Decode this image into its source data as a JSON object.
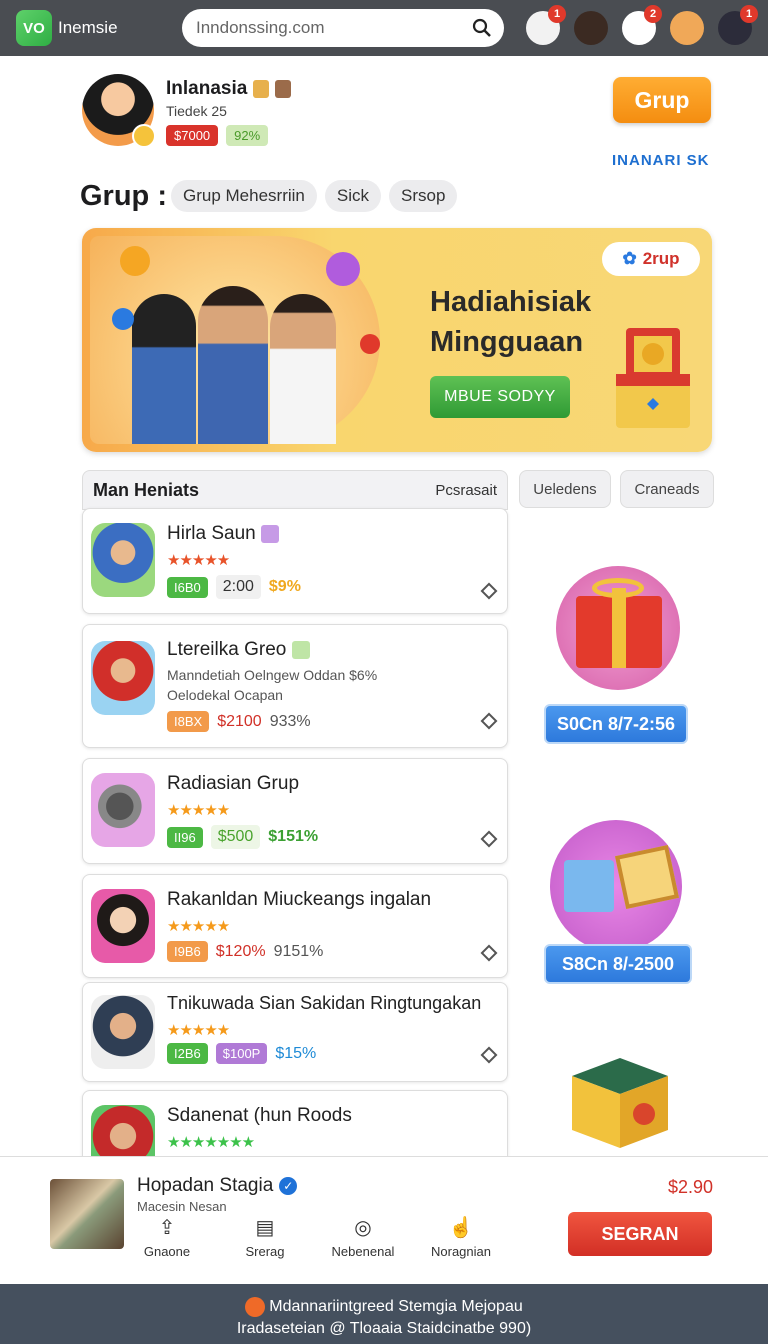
{
  "topbar": {
    "logo": "VO",
    "app_name": "Inemsie",
    "search_value": "Inndonssing.com",
    "icons": [
      {
        "name": "avatar-1-icon",
        "badge": "1",
        "color": "#f2f2f2"
      },
      {
        "name": "avatar-2-icon",
        "badge": "",
        "color": "#3b2a22"
      },
      {
        "name": "notification-icon",
        "badge": "2",
        "color": "#ffffff"
      },
      {
        "name": "avatar-3-icon",
        "badge": "",
        "color": "#f0a858"
      },
      {
        "name": "avatar-4-icon",
        "badge": "1",
        "color": "#2c2c3a"
      }
    ]
  },
  "profile": {
    "name": "Inlanasia",
    "subtitle": "Tiedek  25",
    "tag_price": "$7000",
    "tag_percent": "92%"
  },
  "header": {
    "group_button": "Grup",
    "brand_text": "INANARI SK",
    "group_label": "Grup :",
    "chips": [
      "Grup Mehesrriin",
      "Sick",
      "Srsop"
    ]
  },
  "banner": {
    "title_line1": "Hadiahisiak",
    "title_line2": "Mingguaan",
    "button": "MBUE SODYY",
    "pill": "2rup"
  },
  "list": {
    "header_title": "Man Heniats",
    "header_right": "Pcsrasait",
    "side_tabs": [
      "Ueledens",
      "Craneads"
    ],
    "items": [
      {
        "name": "Hirla Saun",
        "stars": "★★★★★",
        "p1": "I6B0",
        "p2": "2:00",
        "p3": "$9%"
      },
      {
        "name": "Ltereilka Greo",
        "desc1": "Manndetiah Oelngew  Oddan  $6%",
        "desc2": "Oelodekal Ocapan",
        "p1": "I8BX",
        "p2": "$2100",
        "p3": "933%"
      },
      {
        "name": "Radiasian Grup",
        "stars": "★★★★★",
        "p1": "II96",
        "p2": "$500",
        "p3": "$151%"
      },
      {
        "name": "Rakanldan Miuckeangs ingalan",
        "stars": "★★★★★",
        "p1": "I9B6",
        "p2": "$120%",
        "p3": "9151%"
      },
      {
        "name": "Tnikuwada Sian Sakidan Ringtungakan",
        "stars": "★★★★★",
        "p1": "I2B6",
        "p2": "$100P",
        "p3": "$15%"
      },
      {
        "name": "Sdanenat (hun Roods",
        "stars": "★★★★★★★"
      }
    ]
  },
  "gifts": [
    {
      "label": "S0Cn 8/7-2:56"
    },
    {
      "label": "S8Cn 8/-2500"
    }
  ],
  "bottom": {
    "name": "Hopadan Stagia",
    "sub": "Macesin Nesan",
    "price": "$2.90",
    "actions": [
      {
        "icon": "share-icon",
        "label": "Gnaone"
      },
      {
        "icon": "list-icon",
        "label": "Srerag"
      },
      {
        "icon": "compass-icon",
        "label": "Nebenenal"
      },
      {
        "icon": "hand-icon",
        "label": "Noragnian"
      }
    ],
    "buy_button": "SEGRAN"
  },
  "footer": {
    "line1": "Mdannariintgreed Stemgia Mejopau",
    "line2": "Iradaseteian @ Tloaaia Staidcinatbe 990)"
  }
}
